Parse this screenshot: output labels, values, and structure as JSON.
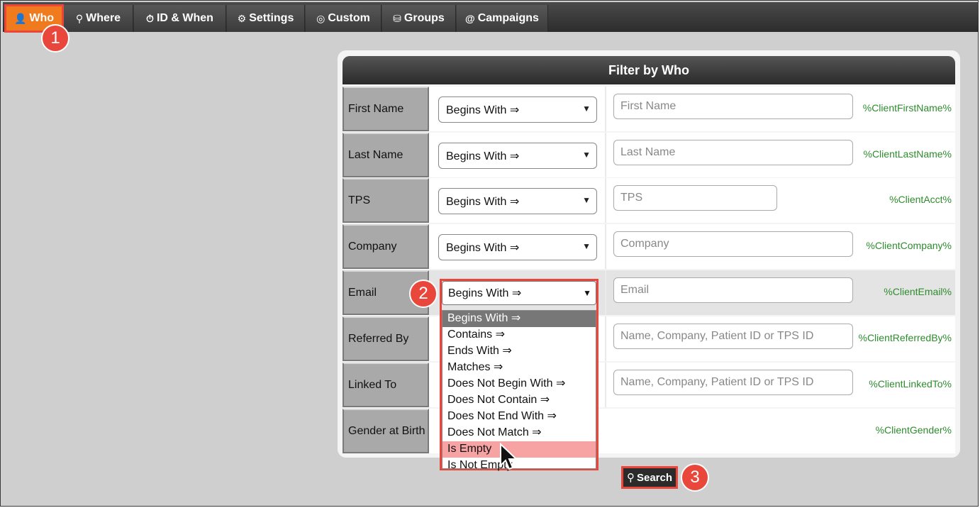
{
  "tabs": [
    {
      "label": "Who",
      "icon": "user-icon",
      "glyph": "👤"
    },
    {
      "label": "Where",
      "icon": "map-pin-icon",
      "glyph": "⚲"
    },
    {
      "label": "ID & When",
      "icon": "clock-icon",
      "glyph": "⏱"
    },
    {
      "label": "Settings",
      "icon": "gear-icon",
      "glyph": "⚙"
    },
    {
      "label": "Custom",
      "icon": "target-icon",
      "glyph": "◎"
    },
    {
      "label": "Groups",
      "icon": "group-icon",
      "glyph": "⛁"
    },
    {
      "label": "Campaigns",
      "icon": "at-icon",
      "glyph": "@"
    }
  ],
  "badges": [
    "1",
    "2",
    "3"
  ],
  "panel": {
    "title": "Filter by Who"
  },
  "rows": [
    {
      "label": "First Name",
      "operator": "Begins With ⇒",
      "placeholder": "First Name",
      "variable": "%ClientFirstName%"
    },
    {
      "label": "Last Name",
      "operator": "Begins With ⇒",
      "placeholder": "Last Name",
      "variable": "%ClientLastName%"
    },
    {
      "label": "TPS",
      "operator": "Begins With ⇒",
      "placeholder": "TPS",
      "variable": "%ClientAcct%"
    },
    {
      "label": "Company",
      "operator": "Begins With ⇒",
      "placeholder": "Company",
      "variable": "%ClientCompany%"
    },
    {
      "label": "Email",
      "operator": "Begins With ⇒",
      "placeholder": "Email",
      "variable": "%ClientEmail%"
    },
    {
      "label": "Referred By",
      "operator": "",
      "placeholder": "Name, Company, Patient ID or TPS ID",
      "variable": "%ClientReferredBy%"
    },
    {
      "label": "Linked To",
      "operator": "",
      "placeholder": "Name, Company, Patient ID or TPS ID",
      "variable": "%ClientLinkedTo%"
    },
    {
      "label": "Gender at Birth",
      "operator": "",
      "placeholder": "",
      "variable": "%ClientGender%"
    }
  ],
  "dropdown": {
    "selected": "Begins With ⇒",
    "options": [
      "Begins With ⇒",
      "Contains ⇒",
      "Ends With ⇒",
      "Matches ⇒",
      "Does Not Begin With ⇒",
      "Does Not Contain ⇒",
      "Does Not End With ⇒",
      "Does Not Match ⇒",
      "Is Empty",
      "Is Not Empty"
    ]
  },
  "search_button": {
    "label": "Search",
    "icon": "search-icon"
  },
  "colors": {
    "accent": "#f07a1e",
    "highlight": "#e9473c",
    "variable_text": "#2e8b2e"
  }
}
